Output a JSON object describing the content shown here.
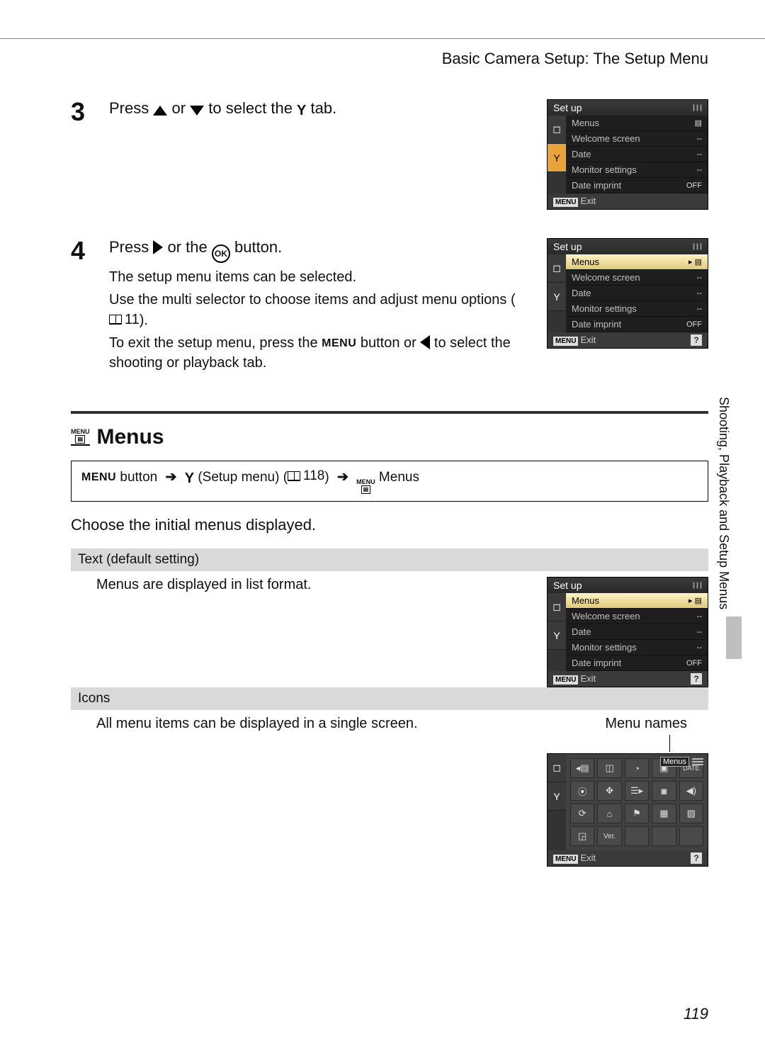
{
  "header": {
    "title": "Basic Camera Setup: The Setup Menu"
  },
  "sideText": "Shooting, Playback and Setup Menus",
  "step3": {
    "num": "3",
    "textBefore": "Press ",
    "textOr": " or ",
    "textAfter": " to select the ",
    "textEnd": " tab."
  },
  "step4": {
    "num": "4",
    "titleBefore": "Press ",
    "titleOr": " or the ",
    "titleAfter": " button.",
    "line1": "The setup menu items can be selected.",
    "line2a": "Use the multi selector to choose items and adjust menu options (",
    "line2ref": "11",
    "line2b": ").",
    "line3a": "To exit the setup menu, press the ",
    "line3menu": "MENU",
    "line3b": " button or ",
    "line3c": " to select the shooting or playback tab."
  },
  "section": {
    "title": "Menus",
    "pathMenu": "MENU",
    "pathButton": " button",
    "pathSetup": " (Setup menu) (",
    "pathRef": "118",
    "pathSetupEnd": ")",
    "pathMenus": " Menus",
    "intro": "Choose the initial menus displayed.",
    "optText": {
      "label": "Text (default setting)",
      "desc": "Menus are displayed in list format."
    },
    "optIcons": {
      "label": "Icons",
      "desc": "All menu items can be displayed in a single screen.",
      "menuNames": "Menu names"
    }
  },
  "cam": {
    "title": "Set up",
    "items": [
      {
        "label": "Menus",
        "val": "▤"
      },
      {
        "label": "Welcome screen",
        "val": "--"
      },
      {
        "label": "Date",
        "val": "--"
      },
      {
        "label": "Monitor settings",
        "val": "--"
      },
      {
        "label": "Date imprint",
        "val": "OFF"
      }
    ],
    "exit": "Exit",
    "menuTag": "MENU",
    "tabs": {
      "camera": "▢",
      "wrench": "⚒"
    },
    "iconMenuName": "Menus"
  },
  "pageNum": "119"
}
